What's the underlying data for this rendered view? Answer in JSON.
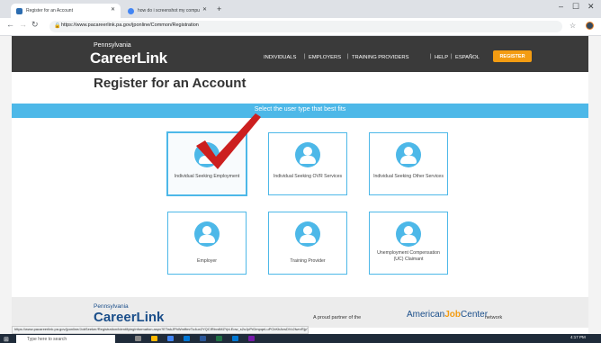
{
  "browser": {
    "tabs": [
      {
        "label": "Register for an Account"
      },
      {
        "label": "how do i screenshot my compu"
      }
    ],
    "new_tab": "+",
    "url": "https://www.pacareerlink.pa.gov/jponline/Common/Registration",
    "status_url": "https://www.pacareerlink.pa.gov/jponline/JobSeeker/Registration/IdentifyingInformation.aspx?ETwkJPhWmffmrTu4ux2YQCIRbvdMZYpLEow_s2oJpPrDmpqeLuPCbKbAvsDVv2lwrvRjpTepFXCDBZPPEMW17upQnfb_tTOIN0ACVI"
  },
  "site": {
    "logo_top": "Pennsylvania",
    "logo_main": "CareerLink",
    "nav": [
      "INDIVIDUALS",
      "EMPLOYERS",
      "TRAINING PROVIDERS",
      "HELP",
      "ESPAÑOL"
    ],
    "nav_sep": "|",
    "register_label": "REGISTER",
    "accent": "#f39c12"
  },
  "main": {
    "title": "Register for an Account",
    "subtitle": "Select the user type that best fits",
    "cards": [
      {
        "label": "Individual Seeking Employment",
        "icon": "user-icon",
        "selected": true
      },
      {
        "label": "Individual Seeking OVR Services",
        "icon": "user-icon"
      },
      {
        "label": "Individual Seeking Other Services",
        "icon": "user-icon"
      },
      {
        "label": "Employer",
        "icon": "user-icon"
      },
      {
        "label": "Training Provider",
        "icon": "user-icon"
      },
      {
        "label": "Unemployment Compensation (UC) Claimant",
        "icon": "user-icon"
      }
    ],
    "card_border": "#4db8e8"
  },
  "footer": {
    "logo_top": "Pennsylvania",
    "logo_main": "CareerLink",
    "partner_text": "A proud partner of the",
    "ajc_american": "American",
    "ajc_job": "Job",
    "ajc_center": "Center",
    "network_text": "network"
  },
  "taskbar": {
    "search_placeholder": "Type here to search",
    "time": "4:17 PM"
  }
}
